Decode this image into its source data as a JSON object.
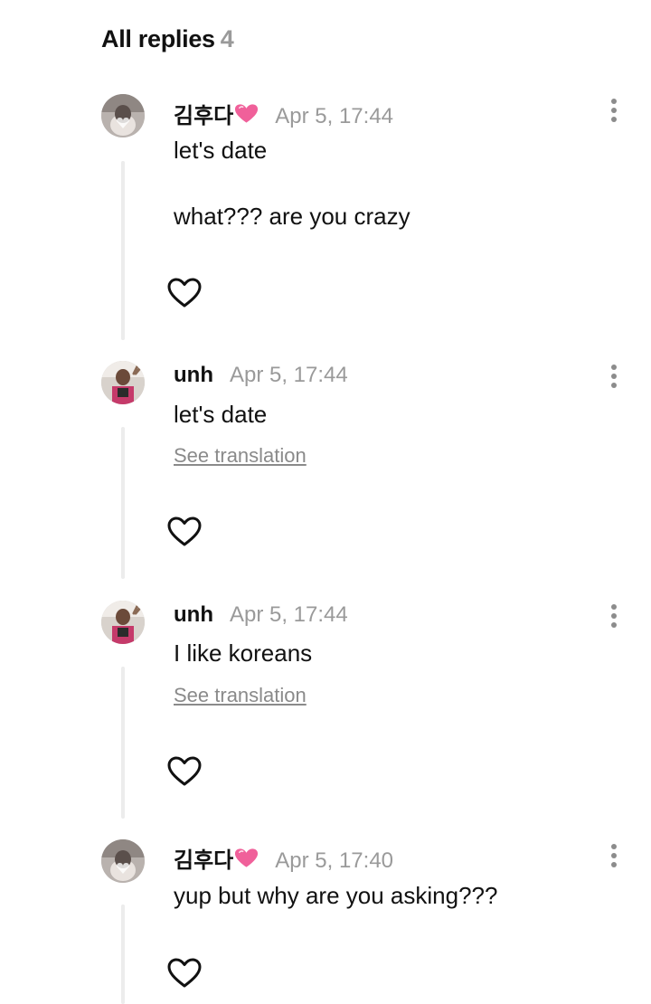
{
  "header": {
    "title": "All replies",
    "count": "4"
  },
  "replies": [
    {
      "username": "김후다",
      "has_heart_emoji": true,
      "timestamp": "Apr 5, 17:44",
      "lines": [
        "let's date",
        "what??? are you crazy"
      ],
      "see_translation": "",
      "avatar": "avatar-heart-hands",
      "like_icon": "heart-outline-icon",
      "menu_icon": "more-vertical-icon"
    },
    {
      "username": "unh",
      "has_heart_emoji": false,
      "timestamp": "Apr 5, 17:44",
      "lines": [
        "let's date"
      ],
      "see_translation": "See translation",
      "avatar": "avatar-selfie",
      "like_icon": "heart-outline-icon",
      "menu_icon": "more-vertical-icon"
    },
    {
      "username": "unh",
      "has_heart_emoji": false,
      "timestamp": "Apr 5, 17:44",
      "lines": [
        "I like koreans"
      ],
      "see_translation": "See translation",
      "avatar": "avatar-selfie",
      "like_icon": "heart-outline-icon",
      "menu_icon": "more-vertical-icon"
    },
    {
      "username": "김후다",
      "has_heart_emoji": true,
      "timestamp": "Apr 5, 17:40",
      "lines": [
        "yup but why are you asking???"
      ],
      "see_translation": "",
      "avatar": "avatar-heart-hands",
      "like_icon": "heart-outline-icon",
      "menu_icon": "more-vertical-icon"
    }
  ],
  "colors": {
    "text": "#111111",
    "muted": "#9a9a9a",
    "link": "#8a8a8a",
    "thread_line": "#ececec",
    "heart_emoji": "#f0609a"
  }
}
